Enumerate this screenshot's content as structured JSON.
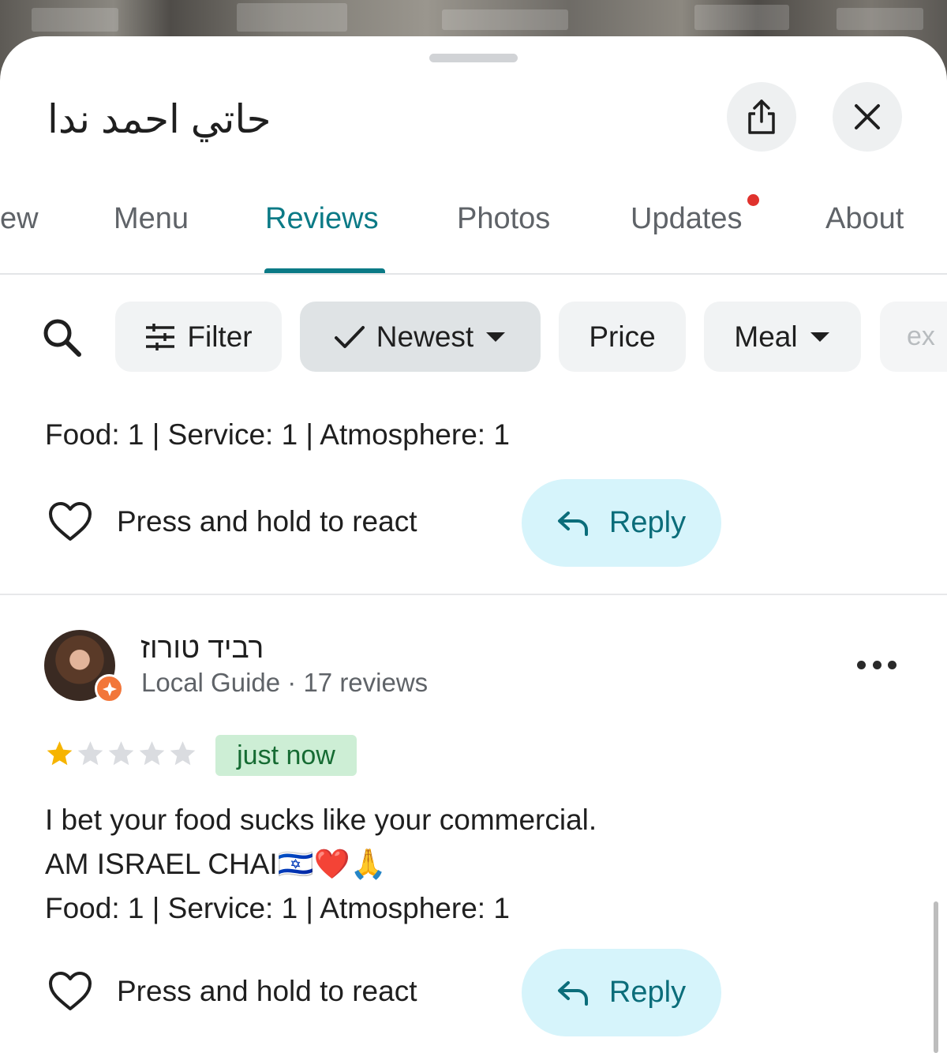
{
  "place": {
    "title": "حاتي احمد ندا"
  },
  "header": {
    "share_icon": "share-icon",
    "close_icon": "close-icon"
  },
  "tabs": [
    {
      "label": "ew",
      "active": false
    },
    {
      "label": "Menu",
      "active": false
    },
    {
      "label": "Reviews",
      "active": true
    },
    {
      "label": "Photos",
      "active": false
    },
    {
      "label": "Updates",
      "active": false,
      "has_dot": true
    },
    {
      "label": "About",
      "active": false
    }
  ],
  "filters": {
    "search_icon": "search-icon",
    "filter_label": "Filter",
    "newest_label": "Newest",
    "price_label": "Price",
    "meal_label": "Meal",
    "partial_label": "ex"
  },
  "review_1": {
    "ratings_line": "Food: 1 | Service: 1 | Atmosphere: 1",
    "react_label": "Press and hold to react",
    "reply_label": "Reply"
  },
  "review_2": {
    "author": "רביד טורוז",
    "author_meta": "Local Guide · 17 reviews",
    "stars": 1,
    "stars_max": 5,
    "time": "just now",
    "text_line_1": "I bet your food sucks like your commercial.",
    "text_line_2": "AM ISRAEL CHAI🇮🇱❤️🙏",
    "ratings_line": "Food: 1 | Service: 1 | Atmosphere: 1",
    "react_label": "Press and hold to react",
    "reply_label": "Reply"
  },
  "colors": {
    "accent": "#0b7a86",
    "reply_bg": "#d6f4fb",
    "badge_bg": "#cdeed5",
    "star_filled": "#f6b400",
    "star_empty": "#dadce0",
    "notification_dot": "#e0322d"
  }
}
